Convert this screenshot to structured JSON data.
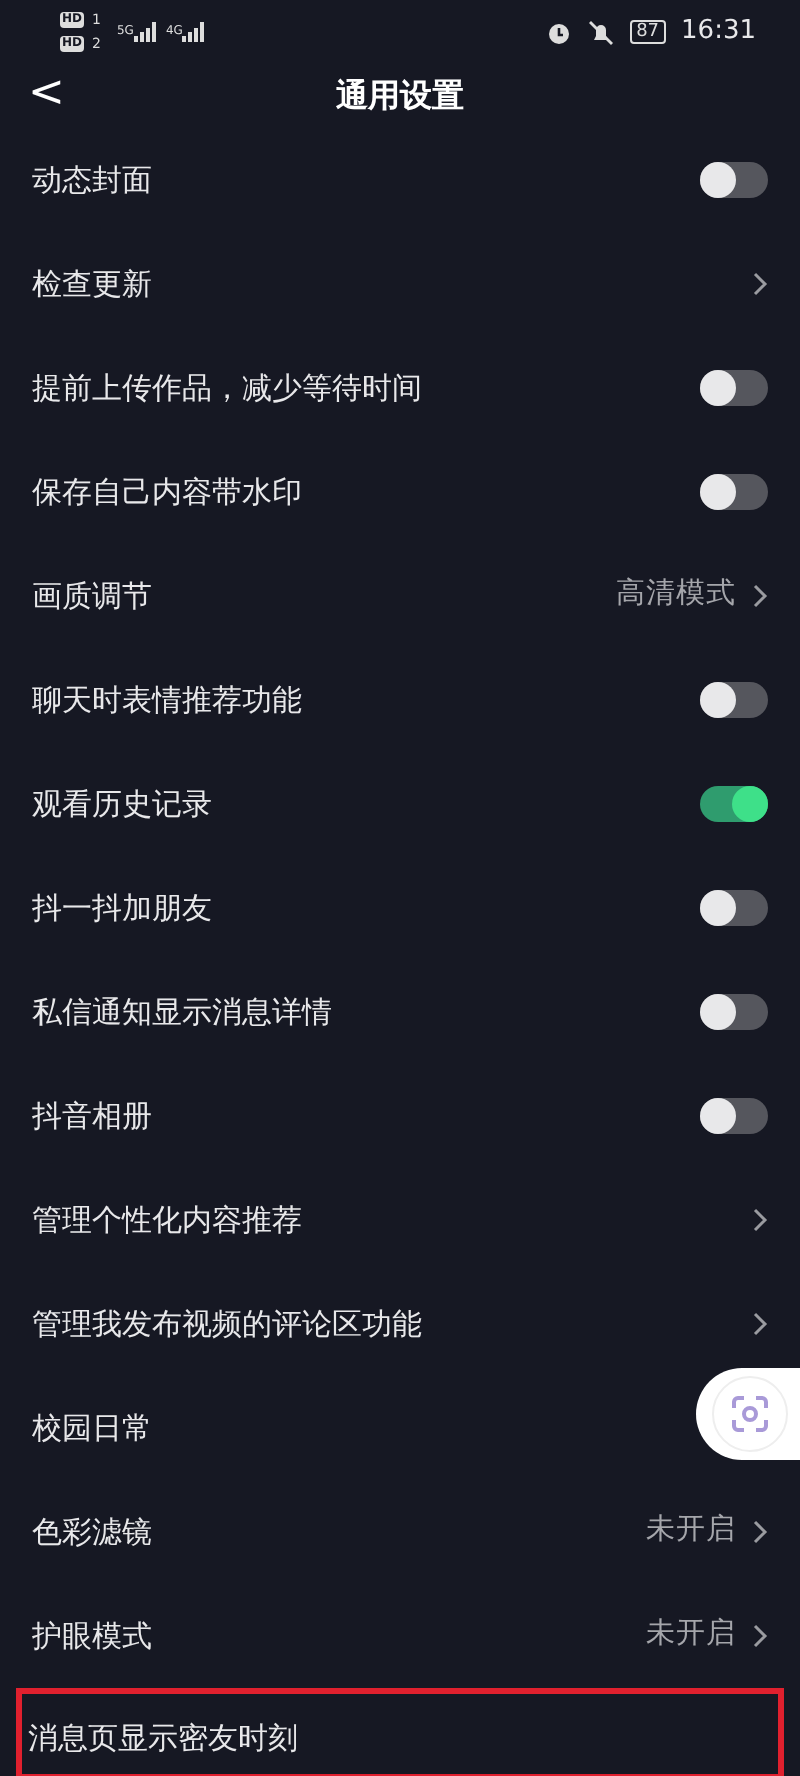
{
  "status_bar": {
    "sims": [
      {
        "label": "HD",
        "slot": "1",
        "network": "5G"
      },
      {
        "label": "HD",
        "slot": "2",
        "network": "4G"
      }
    ],
    "battery": "87",
    "time": "16:31"
  },
  "header": {
    "title": "通用设置",
    "back": "<"
  },
  "settings": [
    {
      "label": "动态封面",
      "kind": "toggle",
      "on": false
    },
    {
      "label": "检查更新",
      "kind": "link"
    },
    {
      "label": "提前上传作品，减少等待时间",
      "kind": "toggle",
      "on": false
    },
    {
      "label": "保存自己内容带水印",
      "kind": "toggle",
      "on": false
    },
    {
      "label": "画质调节",
      "kind": "link",
      "value": "高清模式"
    },
    {
      "label": "聊天时表情推荐功能",
      "kind": "toggle",
      "on": false
    },
    {
      "label": "观看历史记录",
      "kind": "toggle",
      "on": true
    },
    {
      "label": "抖一抖加朋友",
      "kind": "toggle",
      "on": false
    },
    {
      "label": "私信通知显示消息详情",
      "kind": "toggle",
      "on": false
    },
    {
      "label": "抖音相册",
      "kind": "toggle",
      "on": false
    },
    {
      "label": "管理个性化内容推荐",
      "kind": "link"
    },
    {
      "label": "管理我发布视频的评论区功能",
      "kind": "link"
    },
    {
      "label": "校园日常",
      "kind": "plain"
    },
    {
      "label": "色彩滤镜",
      "kind": "link",
      "value": "未开启"
    },
    {
      "label": "护眼模式",
      "kind": "link",
      "value": "未开启"
    },
    {
      "label": "消息页显示密友时刻",
      "kind": "plain",
      "highlighted": true
    }
  ],
  "floating_button": {
    "kind": "scan"
  }
}
